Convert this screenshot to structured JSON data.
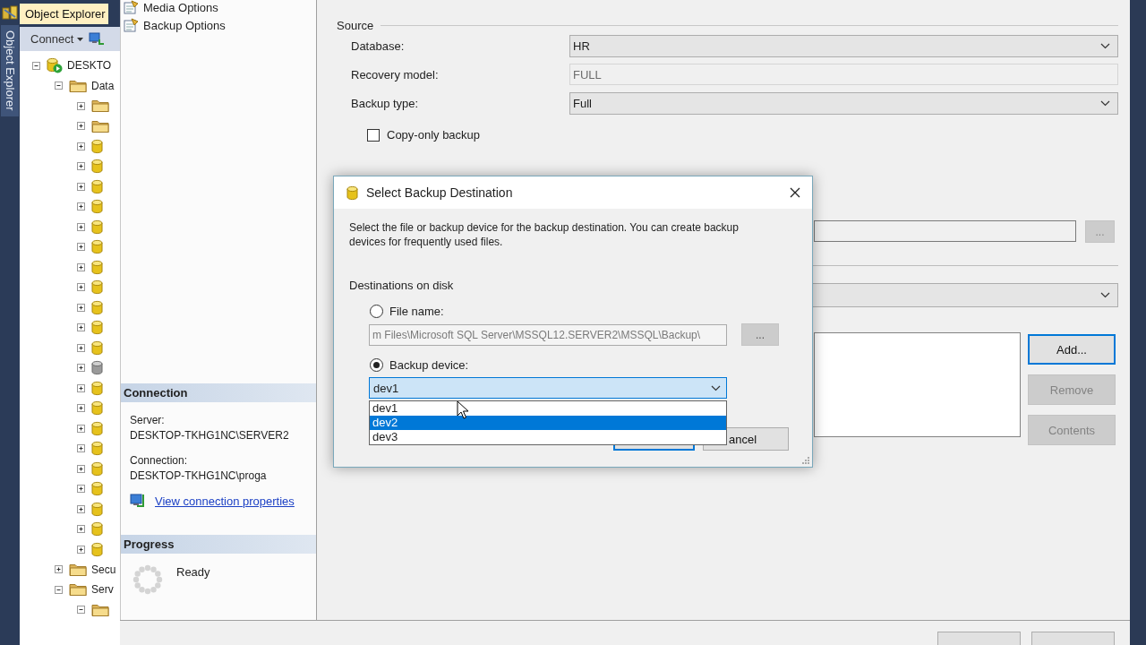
{
  "side_tab": {
    "label": "Object Explorer"
  },
  "object_explorer": {
    "title": "Object Explorer",
    "connect": "Connect"
  },
  "tree": [
    {
      "label": "DESKTO",
      "kind": "server",
      "expanded": true,
      "children": [
        {
          "label": "Data",
          "kind": "folder",
          "expanded": true,
          "children": [
            {
              "kind": "folder",
              "expanded": false
            },
            {
              "kind": "folder",
              "expanded": false
            },
            {
              "kind": "database",
              "expanded": false
            },
            {
              "kind": "database",
              "expanded": false
            },
            {
              "kind": "database",
              "expanded": false
            },
            {
              "kind": "database",
              "expanded": false
            },
            {
              "kind": "database",
              "expanded": false
            },
            {
              "kind": "database",
              "expanded": false
            },
            {
              "kind": "database",
              "expanded": false
            },
            {
              "kind": "database",
              "expanded": false
            },
            {
              "kind": "database",
              "expanded": false
            },
            {
              "kind": "database",
              "expanded": false
            },
            {
              "kind": "database",
              "expanded": false
            },
            {
              "kind": "database_offline",
              "expanded": false
            },
            {
              "kind": "database",
              "expanded": false
            },
            {
              "kind": "database",
              "expanded": false
            },
            {
              "kind": "database",
              "expanded": false
            },
            {
              "kind": "database",
              "expanded": false
            },
            {
              "kind": "database",
              "expanded": false
            },
            {
              "kind": "database",
              "expanded": false
            },
            {
              "kind": "database",
              "expanded": false
            },
            {
              "kind": "database",
              "expanded": false
            },
            {
              "kind": "database",
              "expanded": false
            }
          ]
        },
        {
          "label": "Secu",
          "kind": "folder",
          "expanded": false
        },
        {
          "label": "Serv",
          "kind": "folder",
          "expanded": true,
          "children": [
            {
              "kind": "folder",
              "expanded": true
            }
          ]
        }
      ]
    }
  ],
  "pages": [
    {
      "label": "Media Options"
    },
    {
      "label": "Backup Options"
    }
  ],
  "connection": {
    "title": "Connection",
    "server_label": "Server:",
    "server": "DESKTOP-TKHG1NC\\SERVER2",
    "connection_label": "Connection:",
    "connection": "DESKTOP-TKHG1NC\\proga",
    "link": "View connection properties"
  },
  "progress": {
    "title": "Progress",
    "status": "Ready"
  },
  "source": {
    "title": "Source",
    "fields": [
      {
        "label": "Database:",
        "kind": "dropdown",
        "value": "HR"
      },
      {
        "label": "Recovery model:",
        "kind": "readonly",
        "value": "FULL"
      },
      {
        "label": "Backup type:",
        "kind": "dropdown",
        "value": "Full"
      }
    ],
    "copy_only": {
      "label": "Copy-only backup",
      "checked": false
    }
  },
  "destination": {
    "browse": "...",
    "buttons": [
      {
        "label": "Add...",
        "focused": true,
        "disabled": false
      },
      {
        "label": "Remove",
        "focused": false,
        "disabled": true
      },
      {
        "label": "Contents",
        "focused": false,
        "disabled": true
      }
    ]
  },
  "dialog": {
    "title": "Select Backup Destination",
    "description": "Select the file or backup device for the backup destination. You can create backup devices for frequently used files.",
    "group_label": "Destinations on disk",
    "options": [
      {
        "label": "File name:",
        "selected": false
      },
      {
        "label": "Backup device:",
        "selected": true
      }
    ],
    "file_name": "m Files\\Microsoft SQL Server\\MSSQL12.SERVER2\\MSSQL\\Backup\\",
    "browse": "...",
    "device": "dev1",
    "device_options": [
      {
        "label": "dev1",
        "selected": false
      },
      {
        "label": "dev2",
        "selected": true
      },
      {
        "label": "dev3",
        "selected": false
      }
    ],
    "cancel": "ancel"
  }
}
